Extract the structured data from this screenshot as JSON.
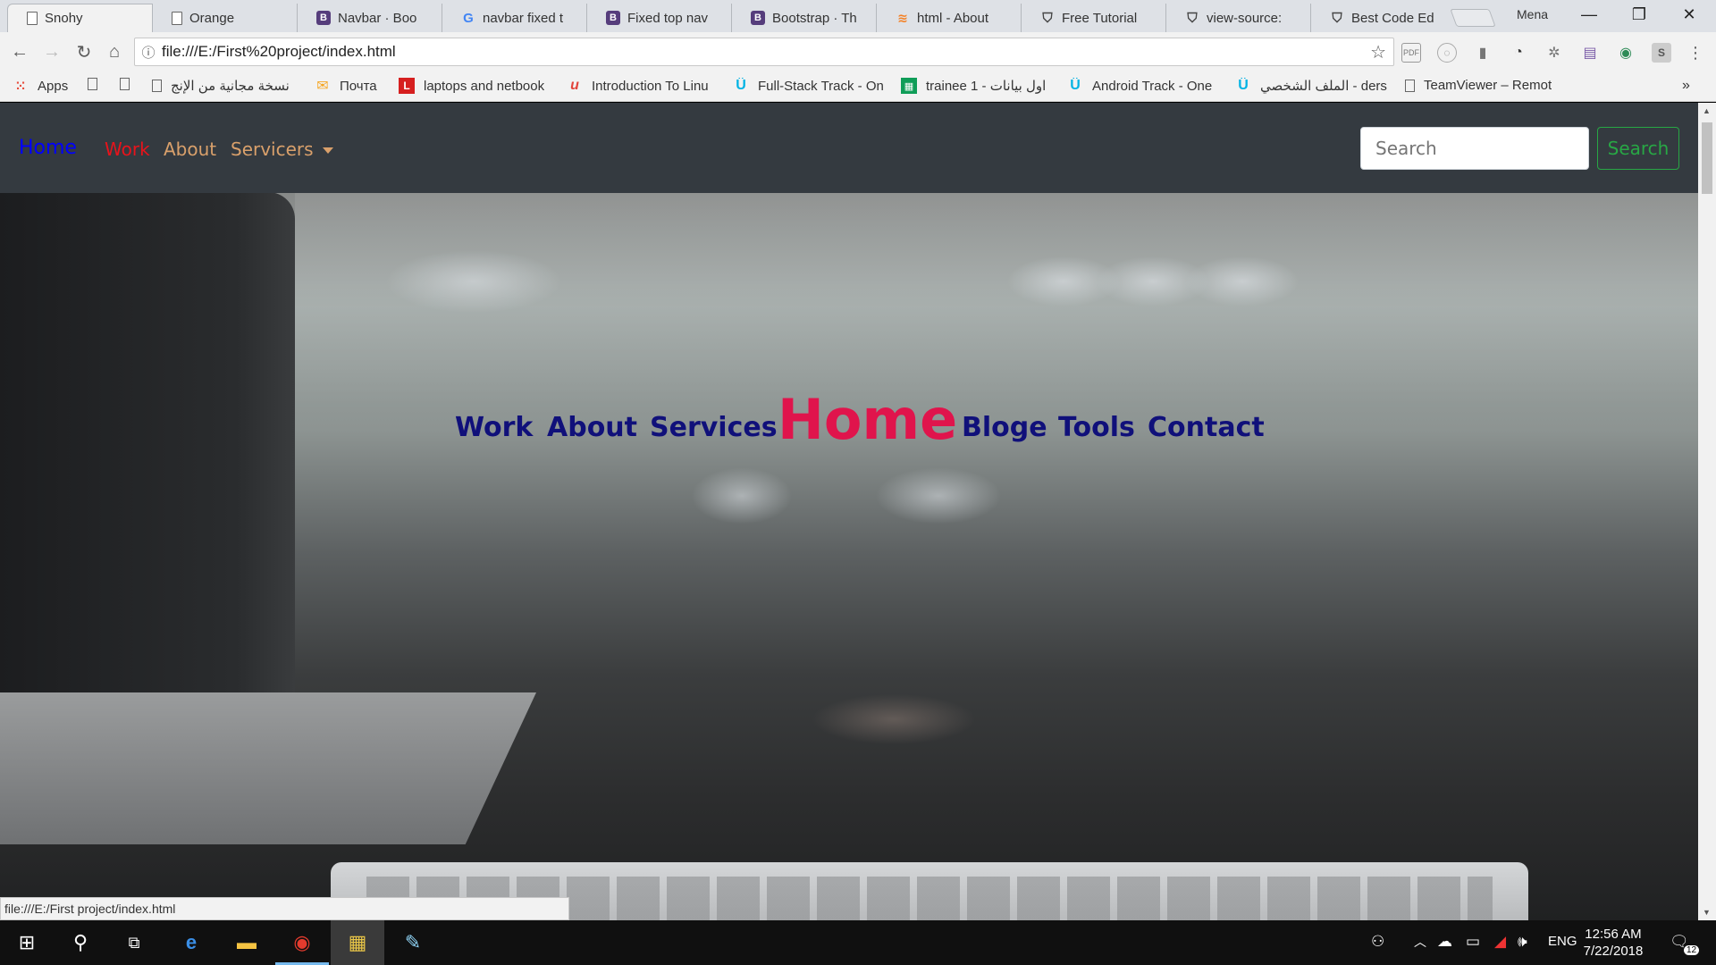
{
  "browser": {
    "tabs": [
      {
        "title": "Snohy",
        "icon": "page-icon",
        "active": true
      },
      {
        "title": "Orange",
        "icon": "page-icon"
      },
      {
        "title": "Navbar · Boo",
        "icon": "bootstrap-icon"
      },
      {
        "title": "navbar fixed t",
        "icon": "google-icon"
      },
      {
        "title": "Fixed top nav",
        "icon": "bootstrap-icon"
      },
      {
        "title": "Bootstrap · Th",
        "icon": "bootstrap-icon"
      },
      {
        "title": "html - About",
        "icon": "stackoverflow-icon"
      },
      {
        "title": "Free Tutorial",
        "icon": "shield-icon"
      },
      {
        "title": "view-source:",
        "icon": "shield-icon"
      },
      {
        "title": "Best Code Ed",
        "icon": "shield-icon"
      }
    ],
    "profile_name": "Mena",
    "address": "file:///E:/First%20project/index.html",
    "bookmarks": [
      {
        "label": "Apps",
        "icon": "apps-grid-icon"
      },
      {
        "label": "",
        "icon": "page-icon"
      },
      {
        "label": "",
        "icon": "page-icon"
      },
      {
        "label": "نسخة مجانية من الإنج",
        "icon": "page-icon"
      },
      {
        "label": "Почта",
        "icon": "mail-icon"
      },
      {
        "label": "laptops and netbook",
        "icon": "l-logo-icon"
      },
      {
        "label": "Introduction To Linu",
        "icon": "udemy-icon"
      },
      {
        "label": "Full-Stack Track - On",
        "icon": "udacity-icon"
      },
      {
        "label": "trainee 1 - اول بيانات",
        "icon": "sheets-icon"
      },
      {
        "label": "Android Track - One",
        "icon": "udacity-icon"
      },
      {
        "label": "الملف الشخصي - ders",
        "icon": "udacity-icon"
      },
      {
        "label": "TeamViewer – Remot",
        "icon": "page-icon"
      }
    ],
    "status_url": "file:///E:/First project/index.html"
  },
  "site": {
    "nav": {
      "home": "Home",
      "work": "Work",
      "about": "About",
      "services": "Servicers",
      "search_placeholder": "Search",
      "search_button": "Search"
    },
    "hero_menu": {
      "work": "Work",
      "about": "About",
      "services": "Services",
      "home": "Home",
      "bloge": "Bloge",
      "tools": "Tools",
      "contact": "Contact"
    },
    "colors": {
      "nav_bg": "#343a40",
      "nav_home": "#0000ff",
      "nav_work": "#e8131b",
      "nav_link": "#d9a06b",
      "search_green": "#28a745",
      "hero_link": "#10107a",
      "hero_home": "#e0144c"
    }
  },
  "taskbar": {
    "language": "ENG",
    "time": "12:56 AM",
    "date": "7/22/2018",
    "notifications": "12"
  }
}
